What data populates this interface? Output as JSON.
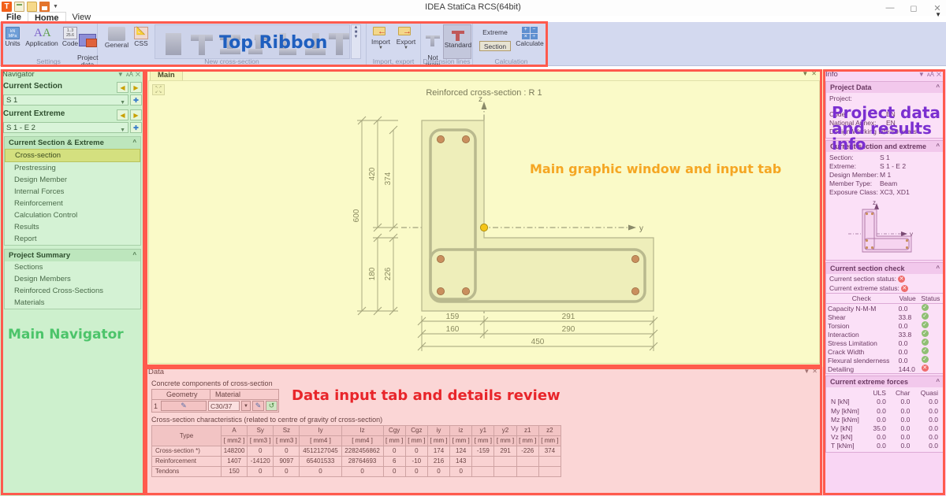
{
  "app": {
    "title": "IDEA StatiCa RCS(64bit)",
    "quick_access": [
      "app-icon",
      "new-icon",
      "open-icon",
      "save-icon",
      "qat-dropdown-icon"
    ],
    "window_controls": [
      "minimize",
      "maximize",
      "close"
    ],
    "menu_tabs": [
      {
        "label": "File",
        "active": false
      },
      {
        "label": "Home",
        "active": true
      },
      {
        "label": "View",
        "active": false
      }
    ]
  },
  "ribbon": {
    "groups": [
      {
        "label": "Settings"
      },
      {
        "label": "New cross-section"
      },
      {
        "label": "Import, export"
      },
      {
        "label": "Dimension lines"
      },
      {
        "label": "Calculation"
      }
    ],
    "settings_items": [
      {
        "label": "Units",
        "icon": "units-icon"
      },
      {
        "label": "Application",
        "icon": "application-icon"
      },
      {
        "label": "Code",
        "icon": "code-icon"
      },
      {
        "label": "Project\ndata",
        "icon": "project-data-icon"
      }
    ],
    "crosssection_items": [
      {
        "label": "General",
        "icon": "general-shape-icon"
      },
      {
        "label": "CSS",
        "icon": "css-icon"
      }
    ],
    "shape_gallery": [
      "rectangle-shape",
      "tee-shape",
      "i-shape",
      "z-shape",
      "l-shape",
      "inverted-l-shape",
      "tee2-shape"
    ],
    "gallery_scroll": [
      "scroll-up",
      "scroll-down",
      "gallery-more"
    ],
    "importexport_items": [
      {
        "label": "Import",
        "icon": "import-icon"
      },
      {
        "label": "Export",
        "icon": "export-icon"
      }
    ],
    "dimension_items": [
      {
        "label": "Not\ndraw",
        "icon": "not-draw-icon",
        "active": false
      },
      {
        "label": "Standard",
        "icon": "standard-dim-icon",
        "active": true
      }
    ],
    "calculation_items": [
      {
        "label": "Extreme",
        "icon": "extreme-icon"
      },
      {
        "label": "Section",
        "icon": "section-icon"
      },
      {
        "label": "Calculate",
        "icon": "calculate-icon"
      }
    ]
  },
  "navigator": {
    "title": "Navigator",
    "current_section_label": "Current Section",
    "current_section_value": "S 1",
    "current_extreme_label": "Current Extreme",
    "current_extreme_value": "S 1 - E 2",
    "section_group": {
      "header": "Current Section & Extreme",
      "items": [
        {
          "label": "Cross-section",
          "selected": true
        },
        {
          "label": "Prestressing",
          "selected": false
        },
        {
          "label": "Design Member",
          "selected": false
        },
        {
          "label": "Internal Forces",
          "selected": false
        },
        {
          "label": "Reinforcement",
          "selected": false
        },
        {
          "label": "Calculation Control",
          "selected": false
        },
        {
          "label": "Results",
          "selected": false
        },
        {
          "label": "Report",
          "selected": false
        }
      ]
    },
    "summary_group": {
      "header": "Project Summary",
      "items": [
        {
          "label": "Sections"
        },
        {
          "label": "Design Members"
        },
        {
          "label": "Reinforced Cross-Sections"
        },
        {
          "label": "Materials"
        }
      ]
    }
  },
  "main_pane": {
    "tab_label": "Main",
    "drawing_title": "Reinforced cross-section : R 1",
    "axis_z": "z",
    "axis_y": "y",
    "dimensions": {
      "vertical_left": "600",
      "vertical_mid": "420",
      "vertical_inner": "374",
      "vertical_lower_left": "180",
      "vertical_lower_mid": "226",
      "horiz_inner_left": "159",
      "horiz_inner_right": "291",
      "horiz_mid_left": "160",
      "horiz_mid_right": "290",
      "horiz_total": "450"
    }
  },
  "data_pane": {
    "title": "Data",
    "concrete_label": "Concrete components of cross-section",
    "concrete_table": {
      "headers": [
        "Geometry",
        "Material"
      ],
      "rows": [
        {
          "index": "1",
          "geometry": "",
          "material": "C30/37"
        }
      ]
    },
    "characteristics_label": "Cross-section characteristics (related to centre of gravity of cross-section)",
    "characteristics_table": {
      "headers": [
        "Type",
        "A",
        "Sy",
        "Sz",
        "Iy",
        "Iz",
        "Cgy",
        "Cgz",
        "iy",
        "iz",
        "y1",
        "y2",
        "z1",
        "z2"
      ],
      "units": [
        "",
        "[ mm2 ]",
        "[ mm3 ]",
        "[ mm3 ]",
        "[ mm4 ]",
        "[ mm4 ]",
        "[ mm ]",
        "[ mm ]",
        "[ mm ]",
        "[ mm ]",
        "[ mm ]",
        "[ mm ]",
        "[ mm ]",
        "[ mm ]"
      ],
      "rows": [
        [
          "Cross-section *)",
          "148200",
          "0",
          "0",
          "4512127045",
          "2282456862",
          "0",
          "0",
          "174",
          "124",
          "-159",
          "291",
          "-226",
          "374"
        ],
        [
          "Reinforcement",
          "1407",
          "-14120",
          "9097",
          "65401533",
          "28764693",
          "6",
          "-10",
          "216",
          "143",
          "",
          "",
          "",
          ""
        ],
        [
          "Tendons",
          "150",
          "0",
          "0",
          "0",
          "0",
          "0",
          "0",
          "0",
          "0",
          "",
          "",
          "",
          ""
        ]
      ]
    }
  },
  "info_pane": {
    "title": "Info",
    "project_data": {
      "header": "Project Data",
      "rows": [
        {
          "key": "Project:",
          "value": ""
        },
        {
          "key": "",
          "value": ""
        },
        {
          "key": "Code:",
          "value": "EN"
        },
        {
          "key": "National Annex:",
          "value": "EN"
        },
        {
          "key": "Design Working Life:",
          "value": "50 years"
        }
      ]
    },
    "current_section": {
      "header": "Current section and extreme",
      "rows": [
        {
          "key": "Section:",
          "value": "S 1"
        },
        {
          "key": "Extreme:",
          "value": "S 1 - E 2"
        },
        {
          "key": "Design Member:",
          "value": "M 1"
        },
        {
          "key": "Member Type:",
          "value": "Beam"
        },
        {
          "key": "Exposure Class:",
          "value": "XC3, XD1"
        }
      ],
      "axis_z": "z",
      "axis_y": "y"
    },
    "section_check": {
      "header": "Current section check",
      "section_status_label": "Current section status:",
      "section_status": "bad",
      "extreme_status_label": "Current extreme status:",
      "extreme_status": "bad",
      "table_headers": [
        "Check",
        "Value",
        "Status"
      ],
      "rows": [
        {
          "check": "Capacity N-M-M",
          "value": "0.0",
          "status": "ok"
        },
        {
          "check": "Shear",
          "value": "33.8",
          "status": "ok"
        },
        {
          "check": "Torsion",
          "value": "0.0",
          "status": "ok"
        },
        {
          "check": "Interaction",
          "value": "33.8",
          "status": "ok"
        },
        {
          "check": "Stress Limitation",
          "value": "0.0",
          "status": "ok"
        },
        {
          "check": "Crack Width",
          "value": "0.0",
          "status": "ok"
        },
        {
          "check": "Flexural slenderness",
          "value": "0.0",
          "status": "ok"
        },
        {
          "check": "Detailing",
          "value": "144.0",
          "status": "bad"
        }
      ]
    },
    "extreme_forces": {
      "header": "Current extreme forces",
      "columns": [
        "ULS",
        "Char",
        "Quasi"
      ],
      "rows": [
        {
          "label": "N [kN]",
          "uls": "0.0",
          "char": "0.0",
          "quasi": "0.0"
        },
        {
          "label": "My [kNm]",
          "uls": "0.0",
          "char": "0.0",
          "quasi": "0.0"
        },
        {
          "label": "Mz [kNm]",
          "uls": "0.0",
          "char": "0.0",
          "quasi": "0.0"
        },
        {
          "label": "Vy [kN]",
          "uls": "35.0",
          "char": "0.0",
          "quasi": "0.0"
        },
        {
          "label": "Vz [kN]",
          "uls": "0.0",
          "char": "0.0",
          "quasi": "0.0"
        },
        {
          "label": "T [kNm]",
          "uls": "0.0",
          "char": "0.0",
          "quasi": "0.0"
        }
      ]
    }
  },
  "annotations": [
    {
      "id": "top-ribbon",
      "text": "Top Ribbon",
      "color": "#1f5fbf"
    },
    {
      "id": "main-navigator",
      "text": "Main Navigator",
      "color": "#4cc46a"
    },
    {
      "id": "main-graphic",
      "text": "Main graphic window and input tab",
      "color": "#f5a623"
    },
    {
      "id": "data-input",
      "text": "Data input tab and details review",
      "color": "#e8252a"
    },
    {
      "id": "project-data-info",
      "text": "Project data and results info",
      "color": "#7b2fd0"
    }
  ]
}
